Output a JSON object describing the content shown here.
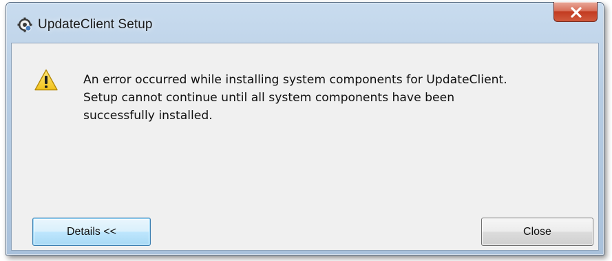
{
  "window": {
    "title": "UpdateClient Setup",
    "icons": {
      "app": "setup-gear-icon",
      "titlebar_close": "close-icon",
      "message": "warning-icon"
    }
  },
  "message": {
    "lines": [
      "An error occurred while installing system components for UpdateClient.",
      "Setup cannot continue until all system components have been",
      "successfully installed."
    ]
  },
  "buttons": {
    "details_label": "Details <<",
    "close_label": "Close"
  },
  "colors": {
    "titlebar": "#b7cde4",
    "client_background": "#f0f0f0",
    "close_button_red": "#c23b21",
    "warning_yellow": "#f7d23a",
    "focused_button_border": "#3c7fb1"
  }
}
